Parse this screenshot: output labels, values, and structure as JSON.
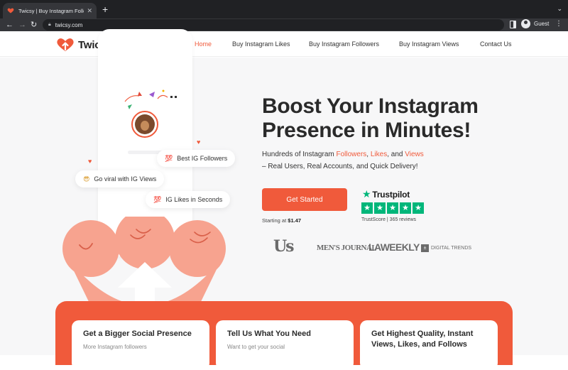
{
  "browser": {
    "tab_title": "Twicsy | Buy Instagram Followers",
    "url": "twicsy.com",
    "profile_label": "Guest"
  },
  "nav": {
    "brand": "Twicsy",
    "links": [
      "Home",
      "Buy Instagram Likes",
      "Buy Instagram Followers",
      "Buy Instagram Views",
      "Contact Us"
    ],
    "active_index": 0
  },
  "hero": {
    "title_line1": "Boost Your Instagram",
    "title_line2": "Presence in Minutes!",
    "sub_prefix": "Hundreds of Instagram ",
    "sub_followers": "Followers",
    "sub_sep1": ", ",
    "sub_likes": "Likes",
    "sub_sep2": ", and ",
    "sub_views": "Views",
    "sub_line2": "– Real Users, Real Accounts, and Quick Delivery!",
    "cta_label": "Get Started",
    "starting_prefix": "Starting at ",
    "starting_price": "$1.47",
    "pills": {
      "best_followers": "Best IG Followers",
      "viral_views": "Go viral with IG Views",
      "likes_seconds": "IG Likes in Seconds"
    },
    "pill_emoji_100": "💯"
  },
  "trustpilot": {
    "name": "Trustpilot",
    "score_text": "TrustScore | 365 reviews",
    "rating_stars": 5
  },
  "press": {
    "us": "Us",
    "mens_journal": "MEN'S JOURNAL",
    "la_weekly": "LAWEEKLY",
    "digital_trends": "DIGITAL TRENDS"
  },
  "cards": [
    {
      "title": "Get a Bigger Social Presence",
      "text": "More Instagram followers"
    },
    {
      "title": "Tell Us What You Need",
      "text": "Want to get your social"
    },
    {
      "title": "Get Highest Quality, Instant Views, Likes, and Follows",
      "text": ""
    }
  ],
  "colors": {
    "accent": "#f05a3b",
    "trustpilot_green": "#00b67a",
    "chrome_dark": "#202124"
  }
}
